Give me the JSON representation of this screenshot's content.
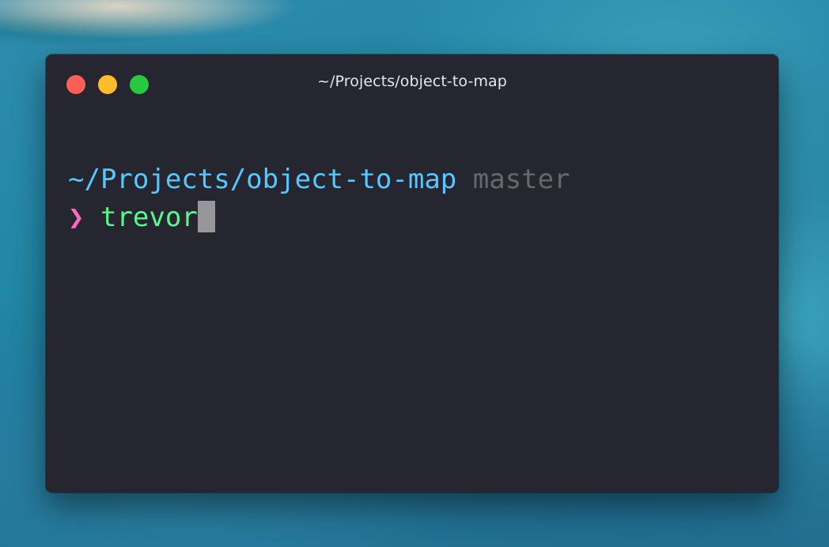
{
  "window": {
    "title": "~/Projects/object-to-map"
  },
  "terminal": {
    "cwd": "~/Projects/object-to-map",
    "branch": "master",
    "prompt_symbol": "❯",
    "input": "trevor"
  },
  "colors": {
    "cwd": "#57c7ff",
    "branch": "#686868",
    "prompt_symbol": "#ff6ac1",
    "input": "#5af78e",
    "cursor": "#97979b",
    "background": "#262630",
    "close": "#ff5f57",
    "minimize": "#febc2e",
    "zoom": "#28c840"
  },
  "icons": {
    "close": "close-button-icon",
    "minimize": "minimize-button-icon",
    "zoom": "zoom-button-icon"
  }
}
